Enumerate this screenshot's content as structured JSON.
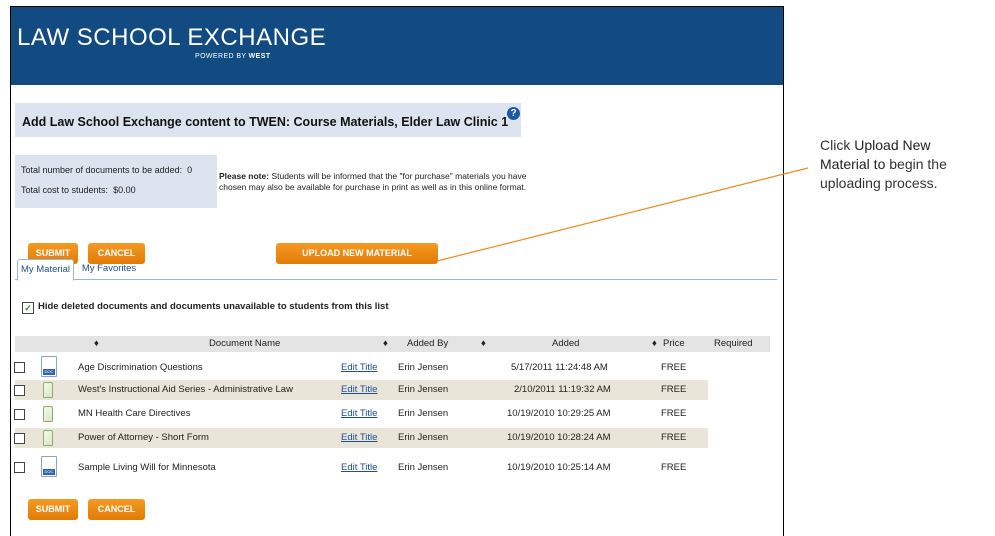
{
  "banner": {
    "brand": "LAW SCHOOL EXCHANGE",
    "powered_prefix": "POWERED BY ",
    "powered_brand": "WEST"
  },
  "header": {
    "title": "Add Law School Exchange content to TWEN: Course Materials, Elder Law Clinic 1",
    "help_icon": "?"
  },
  "totals": {
    "docs_label": "Total number of documents to be added:",
    "docs_value": "0",
    "cost_label": "Total cost to students:",
    "cost_value": "$0.00"
  },
  "note": {
    "prefix": "Please note:",
    "line1": " Students will be informed that the \"for purchase\" materials you have",
    "line2": "chosen may also be available for purchase in print as well as in this online format."
  },
  "buttons": {
    "submit": "SUBMIT",
    "cancel": "CANCEL",
    "upload": "UPLOAD NEW MATERIAL"
  },
  "tabs": [
    {
      "label": "My Material"
    },
    {
      "label": "My Favorites"
    }
  ],
  "filter": {
    "label": "Hide deleted documents and documents unavailable to students from this list",
    "checked": "✓"
  },
  "table": {
    "sort_icon": "♦",
    "columns": {
      "name": "Document Name",
      "added_by": "Added By",
      "added": "Added",
      "price": "Price",
      "required": "Required"
    },
    "rows": [
      {
        "icon": "doc",
        "name": "Age Discrimination Questions",
        "edit": "Edit Title",
        "added_by": "Erin  Jensen",
        "added": "5/17/2011 11:24:48 AM",
        "price": "FREE"
      },
      {
        "icon": "book",
        "name": "West's Instructional Aid Series - Administrative Law",
        "edit": "Edit Title",
        "added_by": "Erin  Jensen",
        "added": "2/10/2011 11:19:32 AM",
        "price": "FREE"
      },
      {
        "icon": "book",
        "name": "MN Health Care Directives",
        "edit": "Edit Title",
        "added_by": "Erin  Jensen",
        "added": "10/19/2010 10:29:25 AM",
        "price": "FREE"
      },
      {
        "icon": "book",
        "name": "Power of Attorney - Short Form",
        "edit": "Edit Title",
        "added_by": "Erin  Jensen",
        "added": "10/19/2010 10:28:24 AM",
        "price": "FREE"
      },
      {
        "icon": "doc",
        "name": "Sample Living Will for Minnesota",
        "edit": "Edit Title",
        "added_by": "Erin  Jensen",
        "added": "10/19/2010 10:25:14 AM",
        "price": "FREE"
      }
    ]
  },
  "callout": {
    "line1_pre": "Click ",
    "line1_bold": "Upload New",
    "line2_bold": "Material to",
    "line2_post": " begin the",
    "line3": "uploading process."
  },
  "colors": {
    "banner": "#124a82",
    "accent_orange": "#e27a07",
    "callout_line": "#f08a1c"
  }
}
